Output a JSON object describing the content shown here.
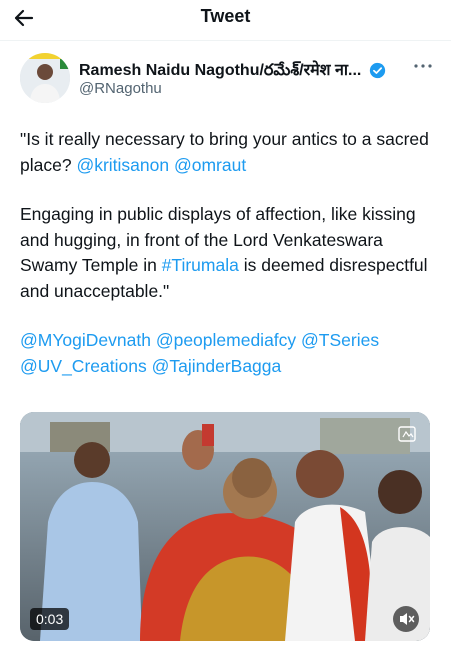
{
  "header": {
    "title": "Tweet",
    "back_icon": "arrow-left-icon"
  },
  "tweet": {
    "author_name": "Ramesh Naidu Nagothu/రమేశ్/रमेश ना...",
    "handle": "@RNagothu",
    "verified": true,
    "paragraph1": {
      "text": "\"Is it really necessary to bring your antics to a sacred place? ",
      "mentions": [
        "@kritisanon",
        "@omraut"
      ]
    },
    "paragraph2": {
      "before": "Engaging in public displays of affection, like kissing and hugging, in front of the Lord Venkateswara Swamy Temple in ",
      "hashtag": "#Tirumala",
      "after": " is deemed disrespectful and unacceptable.\""
    },
    "paragraph3_mentions": [
      "@MYogiDevnath",
      "@peoplemediafcy",
      "@TSeries",
      "@UV_Creations",
      "@TajinderBagga"
    ],
    "media": {
      "type": "video",
      "duration": "0:03"
    }
  },
  "colors": {
    "link": "#1d9bf0",
    "text": "#0f1419",
    "secondary": "#536471",
    "verified": "#1d9bf0"
  }
}
